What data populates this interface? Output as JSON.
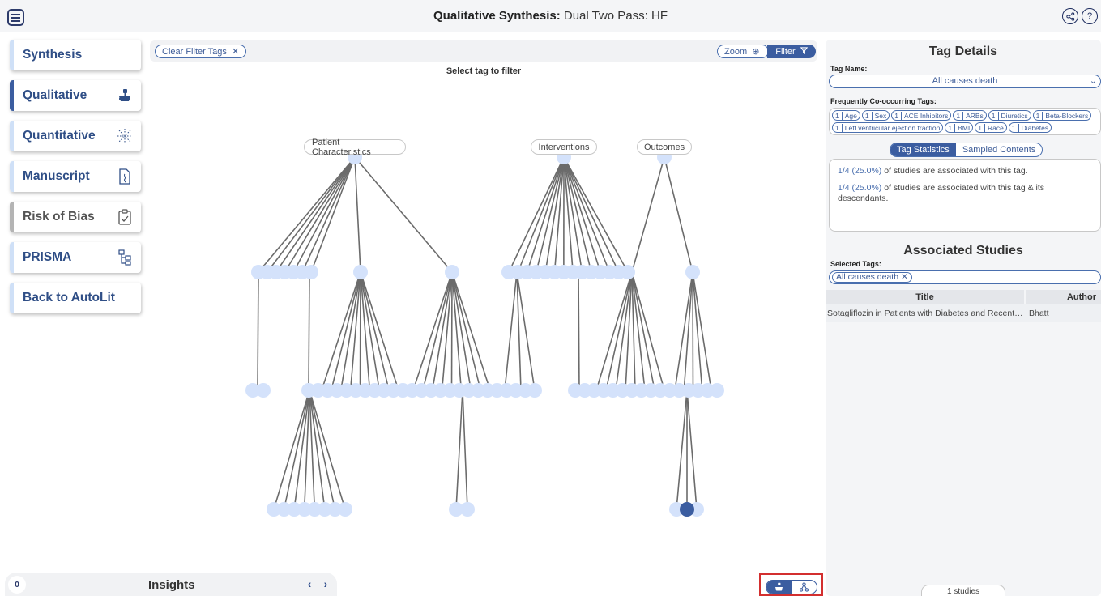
{
  "header": {
    "title_bold": "Qualitative Synthesis:",
    "title_rest": " Dual Two Pass: HF",
    "icons": [
      "menu-icon",
      "share-icon",
      "help-icon"
    ]
  },
  "sidebar": {
    "items": [
      {
        "label": "Synthesis",
        "icon": ""
      },
      {
        "label": "Qualitative",
        "icon": "qualitative-icon"
      },
      {
        "label": "Quantitative",
        "icon": "quantitative-icon"
      },
      {
        "label": "Manuscript",
        "icon": "manuscript-icon"
      },
      {
        "label": "Risk of Bias",
        "icon": "risk-of-bias-icon"
      },
      {
        "label": "PRISMA",
        "icon": "prisma-icon"
      },
      {
        "label": "Back to AutoLit",
        "icon": ""
      }
    ]
  },
  "canvas": {
    "clear_label": "Clear Filter Tags",
    "zoom_label": "Zoom",
    "filter_label": "Filter",
    "hint": "Select tag to filter",
    "roots": [
      "Patient Characteristics",
      "Interventions",
      "Outcomes"
    ]
  },
  "insights": {
    "count": "0",
    "title": "Insights"
  },
  "details": {
    "heading": "Tag Details",
    "tag_name_label": "Tag Name:",
    "tag_name_value": "All causes death",
    "cooccur_label": "Frequently Co-occurring Tags:",
    "cooccur": [
      {
        "n": "1",
        "t": "Age"
      },
      {
        "n": "1",
        "t": "Sex"
      },
      {
        "n": "1",
        "t": "ACE Inhibitors"
      },
      {
        "n": "1",
        "t": "ARBs"
      },
      {
        "n": "1",
        "t": "Diuretics"
      },
      {
        "n": "1",
        "t": "Beta-Blockers"
      },
      {
        "n": "1",
        "t": "Left ventricular ejection fraction"
      },
      {
        "n": "1",
        "t": "BMI"
      },
      {
        "n": "1",
        "t": "Race"
      },
      {
        "n": "1",
        "t": "Diabetes"
      }
    ],
    "tab_stats": "Tag Statistics",
    "tab_sampled": "Sampled Contents",
    "stat1_num": "1/4 (25.0%)",
    "stat1_text": " of studies are associated with this tag.",
    "stat2_num": "1/4 (25.0%)",
    "stat2_text": " of studies are associated with this tag & its descendants."
  },
  "studies": {
    "heading": "Associated Studies",
    "selected_label": "Selected Tags:",
    "selected_tag": "All causes death",
    "col_title": "Title",
    "col_author": "Author",
    "rows": [
      {
        "title": "Sotagliflozin in Patients with Diabetes and Recent Worsening Heart Failure",
        "author": "Bhatt"
      }
    ],
    "count": "1 studies"
  },
  "colors": {
    "accent": "#3b5da0",
    "node": "#d4e2fb",
    "edge": "#6b6b6b",
    "selected_node": "#3b5da0",
    "highlight_box": "#d32f2f"
  }
}
